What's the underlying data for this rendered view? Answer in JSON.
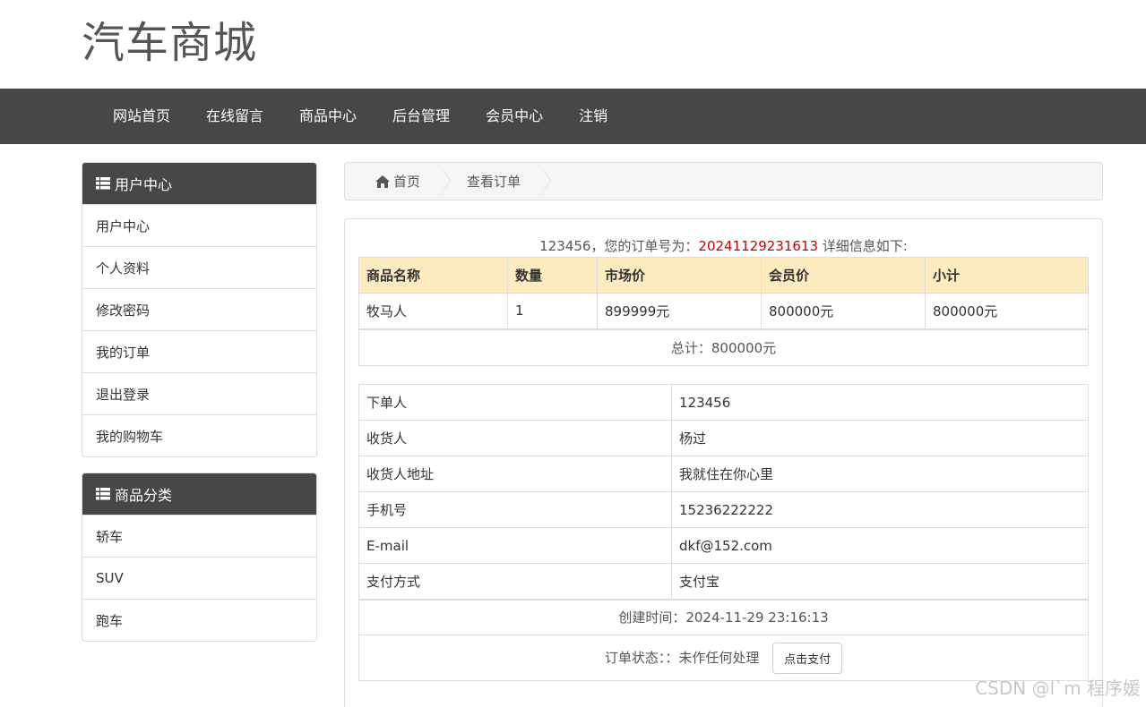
{
  "site": {
    "title": "汽车商城"
  },
  "nav": [
    {
      "label": "网站首页"
    },
    {
      "label": "在线留言"
    },
    {
      "label": "商品中心"
    },
    {
      "label": "后台管理"
    },
    {
      "label": "会员中心"
    },
    {
      "label": "注销"
    }
  ],
  "user_panel": {
    "title": "用户中心",
    "items": [
      "用户中心",
      "个人资料",
      "修改密码",
      "我的订单",
      "退出登录",
      "我的购物车"
    ]
  },
  "category_panel": {
    "title": "商品分类",
    "items": [
      "轿车",
      "SUV",
      "跑车"
    ]
  },
  "breadcrumb": {
    "home": "首页",
    "current": "查看订单"
  },
  "order": {
    "caption_prefix": "123456，您的订单号为：",
    "order_no": "20241129231613",
    "caption_suffix": " 详细信息如下:",
    "headers": [
      "商品名称",
      "数量",
      "市场价",
      "会员价",
      "小计"
    ],
    "rows": [
      [
        "牧马人",
        "1",
        "899999元",
        "800000元",
        "800000元"
      ]
    ],
    "total": "总计：800000元"
  },
  "info": {
    "rows": [
      {
        "label": "下单人",
        "value": "123456"
      },
      {
        "label": "收货人",
        "value": "杨过"
      },
      {
        "label": "收货人地址",
        "value": "我就住在你心里"
      },
      {
        "label": "手机号",
        "value": "15236222222"
      },
      {
        "label": "E-mail",
        "value": "dkf@152.com"
      },
      {
        "label": "支付方式",
        "value": "支付宝"
      }
    ],
    "created": "创建时间：2024-11-29 23:16:13",
    "status": "订单状态：：未作任何处理",
    "pay_button": "点击支付"
  },
  "watermark": "CSDN @l`m 程序媛"
}
